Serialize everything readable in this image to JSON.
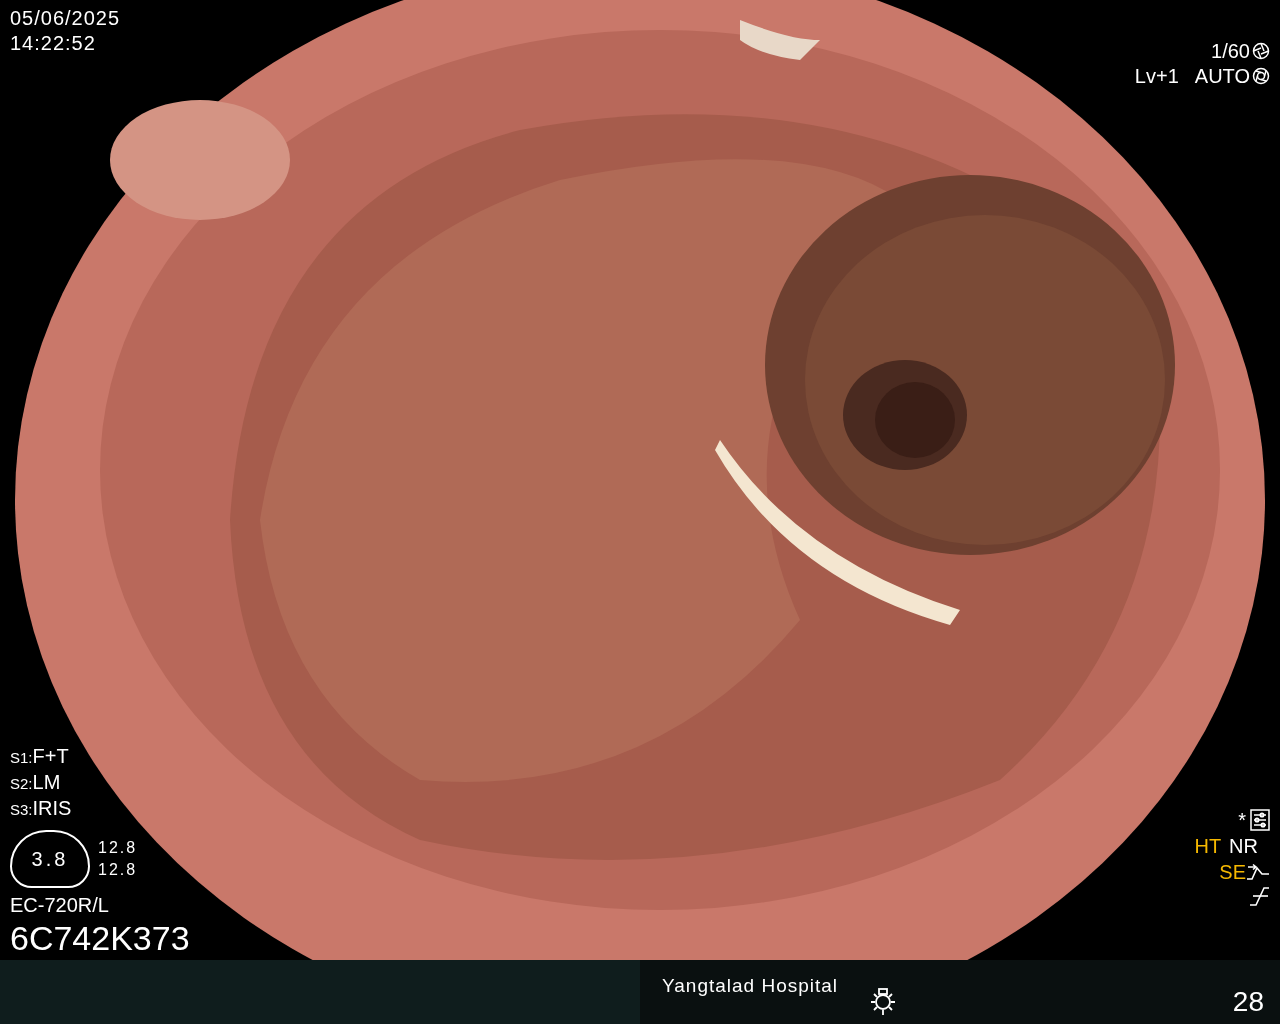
{
  "date": "05/06/2025",
  "time": "14:22:52",
  "shutter": "1/60",
  "brightness": "Lv+1",
  "iris_mode": "AUTO",
  "switches": [
    {
      "key": "S1:",
      "value": "F+T"
    },
    {
      "key": "S2:",
      "value": "LM"
    },
    {
      "key": "S3:",
      "value": "IRIS"
    }
  ],
  "scope_gauge": {
    "value": "3.8",
    "readings": [
      "12.8",
      "12.8"
    ]
  },
  "scope_model": "EC-720R/L",
  "scope_serial": "6C742K373",
  "settings_mark": "*",
  "modes": [
    {
      "label": "HT",
      "active": true
    },
    {
      "label": "NR",
      "active": false
    }
  ],
  "enhancement": {
    "label": "SE",
    "active": true
  },
  "status_bar": {
    "hospital": "Yangtalad Hospital",
    "counter": "28"
  }
}
